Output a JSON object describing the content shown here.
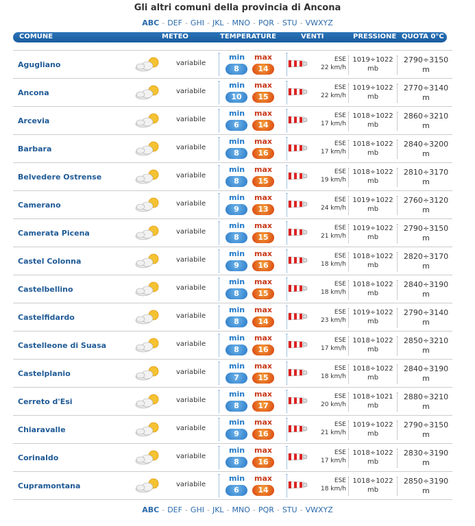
{
  "title": "Gli altri comuni della provincia di Ancona",
  "alphabet": [
    "ABC",
    "DEF",
    "GHI",
    "JKL",
    "MNO",
    "PQR",
    "STU",
    "VWXYZ"
  ],
  "alphabet_active": "ABC",
  "headers": {
    "comune": "COMUNE",
    "meteo": "METEO",
    "temperature": "TEMPERATURE",
    "venti": "VENTI",
    "pressione": "PRESSIONE",
    "quota": "QUOTA 0°C"
  },
  "min_label": "min",
  "max_label": "max",
  "rows": [
    {
      "name": "Agugliano",
      "meteo": "variabile",
      "min": "8",
      "max": "14",
      "wind_dir": "ESE",
      "wind_speed": "22 km/h",
      "press": "1019÷1022",
      "press_unit": "mb",
      "quota": "2790÷3150",
      "quota_unit": "m"
    },
    {
      "name": "Ancona",
      "meteo": "variabile",
      "min": "10",
      "max": "15",
      "wind_dir": "ESE",
      "wind_speed": "22 km/h",
      "press": "1019÷1022",
      "press_unit": "mb",
      "quota": "2770÷3140",
      "quota_unit": "m"
    },
    {
      "name": "Arcevia",
      "meteo": "variabile",
      "min": "6",
      "max": "14",
      "wind_dir": "ESE",
      "wind_speed": "17 km/h",
      "press": "1018÷1022",
      "press_unit": "mb",
      "quota": "2860÷3210",
      "quota_unit": "m"
    },
    {
      "name": "Barbara",
      "meteo": "variabile",
      "min": "8",
      "max": "16",
      "wind_dir": "ESE",
      "wind_speed": "17 km/h",
      "press": "1018÷1022",
      "press_unit": "mb",
      "quota": "2840÷3200",
      "quota_unit": "m"
    },
    {
      "name": "Belvedere Ostrense",
      "meteo": "variabile",
      "min": "8",
      "max": "15",
      "wind_dir": "ESE",
      "wind_speed": "19 km/h",
      "press": "1018÷1022",
      "press_unit": "mb",
      "quota": "2810÷3170",
      "quota_unit": "m"
    },
    {
      "name": "Camerano",
      "meteo": "variabile",
      "min": "9",
      "max": "13",
      "wind_dir": "ESE",
      "wind_speed": "24 km/h",
      "press": "1019÷1022",
      "press_unit": "mb",
      "quota": "2760÷3120",
      "quota_unit": "m"
    },
    {
      "name": "Camerata Picena",
      "meteo": "variabile",
      "min": "8",
      "max": "15",
      "wind_dir": "ESE",
      "wind_speed": "21 km/h",
      "press": "1019÷1022",
      "press_unit": "mb",
      "quota": "2790÷3150",
      "quota_unit": "m"
    },
    {
      "name": "Castel Colonna",
      "meteo": "variabile",
      "min": "9",
      "max": "16",
      "wind_dir": "ESE",
      "wind_speed": "18 km/h",
      "press": "1018÷1022",
      "press_unit": "mb",
      "quota": "2820÷3170",
      "quota_unit": "m"
    },
    {
      "name": "Castelbellino",
      "meteo": "variabile",
      "min": "8",
      "max": "15",
      "wind_dir": "ESE",
      "wind_speed": "18 km/h",
      "press": "1018÷1022",
      "press_unit": "mb",
      "quota": "2840÷3190",
      "quota_unit": "m"
    },
    {
      "name": "Castelfidardo",
      "meteo": "variabile",
      "min": "8",
      "max": "14",
      "wind_dir": "ESE",
      "wind_speed": "23 km/h",
      "press": "1019÷1022",
      "press_unit": "mb",
      "quota": "2790÷3140",
      "quota_unit": "m"
    },
    {
      "name": "Castelleone di Suasa",
      "meteo": "variabile",
      "min": "8",
      "max": "16",
      "wind_dir": "ESE",
      "wind_speed": "17 km/h",
      "press": "1018÷1022",
      "press_unit": "mb",
      "quota": "2850÷3210",
      "quota_unit": "m"
    },
    {
      "name": "Castelplanio",
      "meteo": "variabile",
      "min": "7",
      "max": "15",
      "wind_dir": "ESE",
      "wind_speed": "18 km/h",
      "press": "1018÷1022",
      "press_unit": "mb",
      "quota": "2840÷3190",
      "quota_unit": "m"
    },
    {
      "name": "Cerreto d'Esi",
      "meteo": "variabile",
      "min": "8",
      "max": "17",
      "wind_dir": "ESE",
      "wind_speed": "20 km/h",
      "press": "1018÷1021",
      "press_unit": "mb",
      "quota": "2880÷3210",
      "quota_unit": "m"
    },
    {
      "name": "Chiaravalle",
      "meteo": "variabile",
      "min": "9",
      "max": "16",
      "wind_dir": "ESE",
      "wind_speed": "21 km/h",
      "press": "1019÷1022",
      "press_unit": "mb",
      "quota": "2790÷3150",
      "quota_unit": "m"
    },
    {
      "name": "Corinaldo",
      "meteo": "variabile",
      "min": "8",
      "max": "16",
      "wind_dir": "ESE",
      "wind_speed": "17 km/h",
      "press": "1018÷1022",
      "press_unit": "mb",
      "quota": "2830÷3190",
      "quota_unit": "m"
    },
    {
      "name": "Cupramontana",
      "meteo": "variabile",
      "min": "6",
      "max": "14",
      "wind_dir": "ESE",
      "wind_speed": "18 km/h",
      "press": "1018÷1022",
      "press_unit": "mb",
      "quota": "2850÷3190",
      "quota_unit": "m"
    }
  ]
}
